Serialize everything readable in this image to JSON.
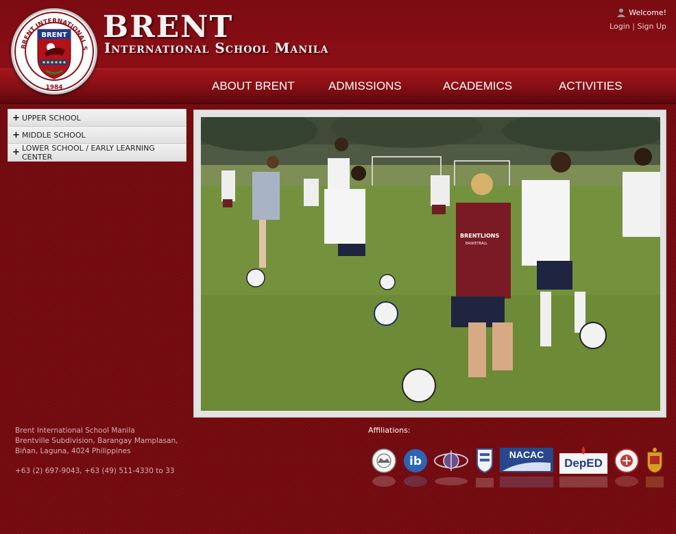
{
  "header": {
    "title_main": "BRENT",
    "title_sub": "International School Manila",
    "logo": {
      "top_text": "BRENT INTERNATIONAL SCHOOL, MANILA",
      "shield_text": "BRENT",
      "year": "1984"
    }
  },
  "user": {
    "welcome": "Welcome!",
    "login": "Login",
    "separator": "|",
    "signup": "Sign Up"
  },
  "nav": {
    "items": [
      {
        "label": "ABOUT BRENT"
      },
      {
        "label": "ADMISSIONS"
      },
      {
        "label": "ACADEMICS"
      },
      {
        "label": "ACTIVITIES"
      }
    ]
  },
  "sidebar": {
    "items": [
      {
        "label": "UPPER SCHOOL"
      },
      {
        "label": "MIDDLE SCHOOL"
      },
      {
        "label": "LOWER SCHOOL / EARLY LEARNING CENTER"
      }
    ]
  },
  "hero": {
    "jersey_text": "BRENTLIONS",
    "jersey_sub": "BASKETBALL"
  },
  "footer": {
    "address_lines": [
      "Brent International School Manila",
      "Brentville Subdivision, Barangay Mamplasan,",
      "Biñan, Laguna, 4024 Philippines"
    ],
    "phone": "+63 (2) 697-9043, +63 (49) 511-4330 to 33",
    "affiliations_label": "Affiliations:",
    "affiliations": [
      {
        "name": "seal",
        "text": ""
      },
      {
        "name": "ib",
        "text": "ib"
      },
      {
        "name": "globe",
        "text": ""
      },
      {
        "name": "shield",
        "text": ""
      },
      {
        "name": "nacac",
        "text": "NACAC"
      },
      {
        "name": "deped",
        "text": "DepED"
      },
      {
        "name": "round-seal",
        "text": ""
      },
      {
        "name": "crest",
        "text": ""
      }
    ]
  },
  "colors": {
    "background": "#7a0d12",
    "nav_band": "#8b1016",
    "sidebar": "#e9e9e9"
  }
}
